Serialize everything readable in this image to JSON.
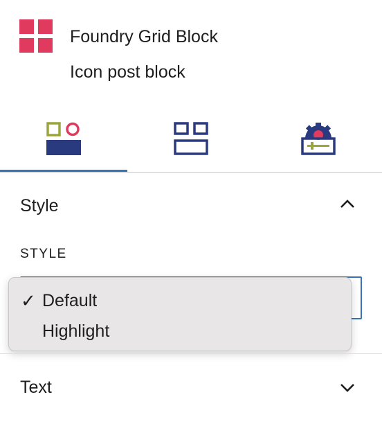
{
  "block": {
    "title": "Foundry Grid Block",
    "description": "Icon post block",
    "icon": "grid-icon",
    "icon_color": "#e03a5f"
  },
  "tabs": [
    {
      "icon": "style-tab-icon",
      "active": true
    },
    {
      "icon": "layout-tab-icon",
      "active": false
    },
    {
      "icon": "settings-tab-icon",
      "active": false
    }
  ],
  "panels": {
    "style": {
      "title": "Style",
      "expanded": true,
      "chevron": "chevron-up-icon"
    },
    "text": {
      "title": "Text",
      "expanded": false,
      "chevron": "chevron-down-icon"
    }
  },
  "style_field": {
    "label": "STYLE",
    "selected": "Default",
    "options": [
      {
        "label": "Default",
        "checked": true,
        "check_mark": "✓"
      },
      {
        "label": "Highlight",
        "checked": false,
        "check_mark": ""
      }
    ]
  },
  "colors": {
    "accent": "#3873b7",
    "brand_pink": "#e03a5f",
    "navy": "#2a3a7e",
    "olive": "#9aa53b"
  }
}
